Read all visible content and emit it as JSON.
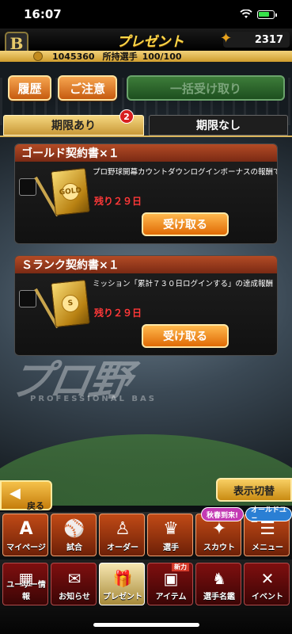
{
  "status_bar": {
    "time": "16:07"
  },
  "header": {
    "logo_letter": "B",
    "title": "プレゼント",
    "coins": "2317"
  },
  "info_bar": {
    "money": "1045360",
    "owned_label": "所持選手",
    "owned_count": "100/100"
  },
  "actions": {
    "history_label": "履歴",
    "notice_label": "ご注意",
    "bulk_receive_label": "一括受け取り"
  },
  "tabs": [
    {
      "label": "期限あり",
      "active": true,
      "badge": "2"
    },
    {
      "label": "期限なし",
      "active": false
    }
  ],
  "presents": [
    {
      "title": "ゴールド契約書×１",
      "description": "プロ野球開幕カウントダウンログインボーナスの報酬です",
      "expire": "残り２９日",
      "button_label": "受け取る",
      "icon_seal": "GOLD"
    },
    {
      "title": "Ｓランク契約書×１",
      "description": "ミッション「累計７３０日ログインする」の達成報酬",
      "expire": "残り２９日",
      "button_label": "受け取る",
      "icon_seal": "S"
    }
  ],
  "background": {
    "brand_text": "プロ野",
    "brand_sub": "PROFESSIONAL BAS"
  },
  "controls": {
    "back_label": "戻る",
    "toggle_label": "表示切替"
  },
  "menu_row1": [
    {
      "label": "マイページ",
      "icon": "A"
    },
    {
      "label": "試合",
      "icon": "⚾"
    },
    {
      "label": "オーダー",
      "icon": "♙"
    },
    {
      "label": "選手",
      "icon": "♛"
    },
    {
      "label": "スカウト",
      "icon": "✦"
    },
    {
      "label": "メニュー",
      "icon": "☰"
    }
  ],
  "menu_row2": [
    {
      "label": "ユーザー情報",
      "icon": "▦"
    },
    {
      "label": "お知らせ",
      "icon": "✉"
    },
    {
      "label": "プレゼント",
      "icon": "🎁"
    },
    {
      "label": "アイテム",
      "icon": "▣"
    },
    {
      "label": "選手名鑑",
      "icon": "♞"
    },
    {
      "label": "イベント",
      "icon": "✕"
    }
  ],
  "bubbles": {
    "scout_promo": "秋春到来!",
    "menu_promo": "オールドユニ"
  },
  "new_tag": "新力",
  "colors": {
    "gold": "#ffd84a",
    "alert_red": "#ff3838",
    "tab_active": "#f5d77f",
    "card_header": "#b34b25",
    "receive_button": "#e06a05",
    "bulk_button": "#3d7c39"
  }
}
